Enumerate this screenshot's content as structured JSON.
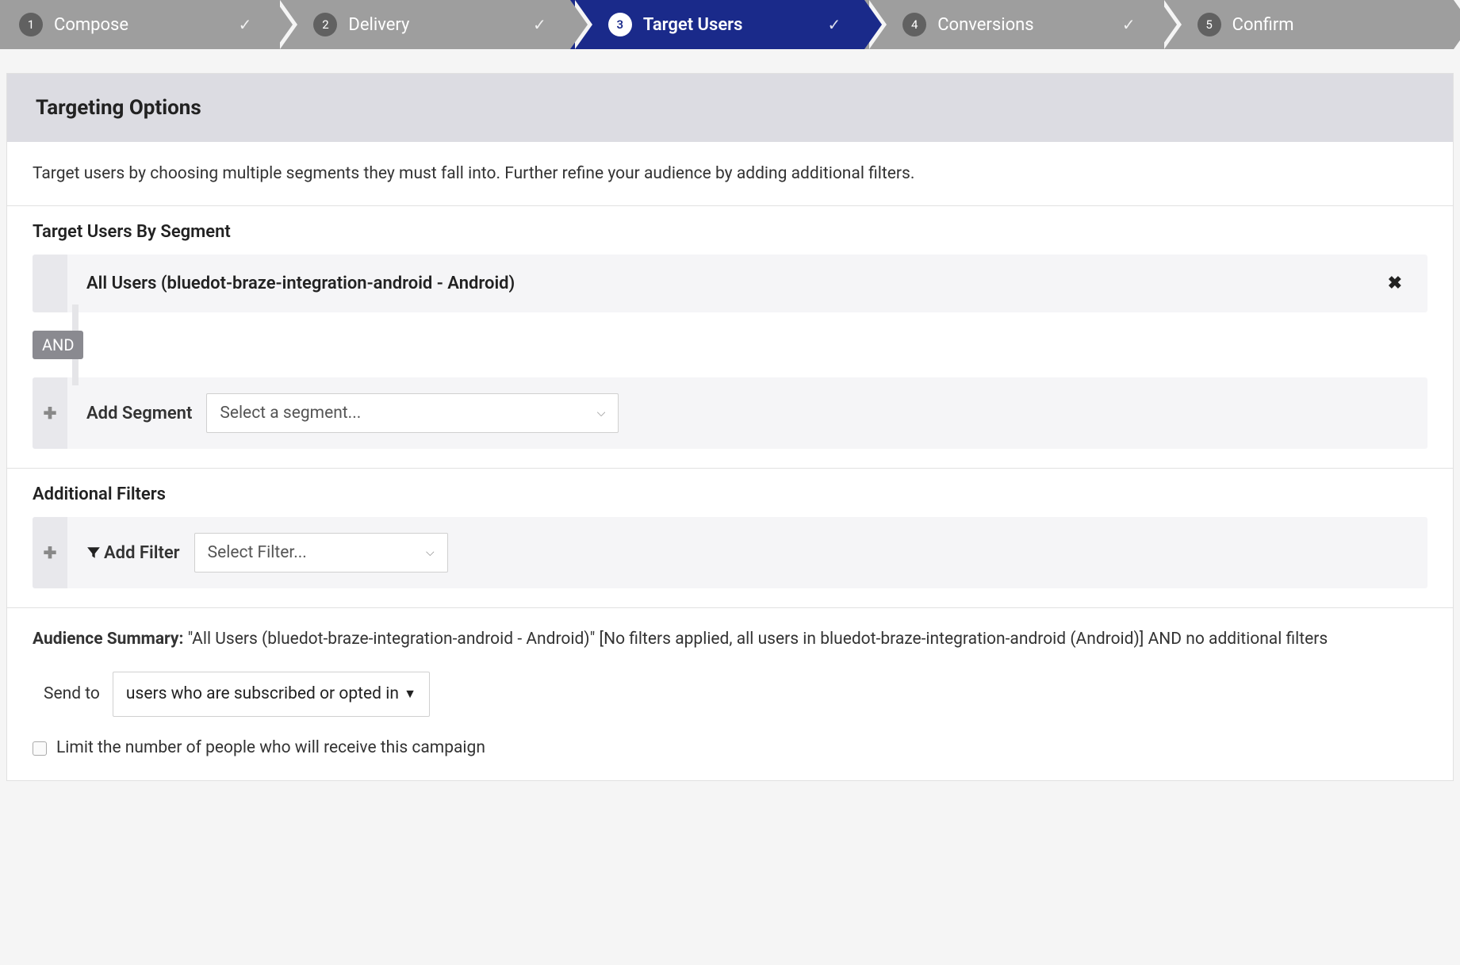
{
  "stepper": {
    "steps": [
      {
        "num": "1",
        "label": "Compose",
        "active": false,
        "checked": true
      },
      {
        "num": "2",
        "label": "Delivery",
        "active": false,
        "checked": true
      },
      {
        "num": "3",
        "label": "Target Users",
        "active": true,
        "checked": true
      },
      {
        "num": "4",
        "label": "Conversions",
        "active": false,
        "checked": true
      },
      {
        "num": "5",
        "label": "Confirm",
        "active": false,
        "checked": false
      }
    ]
  },
  "header": {
    "title": "Targeting Options",
    "description": "Target users by choosing multiple segments they must fall into. Further refine your audience by adding additional filters."
  },
  "segments": {
    "heading": "Target Users By Segment",
    "selected": "All Users (bluedot-braze-integration-android - Android)",
    "connector": "AND",
    "add_label": "Add Segment",
    "select_placeholder": "Select a segment..."
  },
  "filters": {
    "heading": "Additional Filters",
    "add_label": "Add Filter",
    "select_placeholder": "Select Filter..."
  },
  "summary": {
    "label": "Audience Summary:",
    "text": " \"All Users (bluedot-braze-integration-android - Android)\" [No filters applied, all users in bluedot-braze-integration-android (Android)] AND no additional filters",
    "sendto_label": "Send to",
    "sendto_value": "users who are subscribed or opted in",
    "limit_label": "Limit the number of people who will receive this campaign"
  },
  "icons": {
    "check": "✓",
    "plus": "✚",
    "close": "✖",
    "chevron": "⌵",
    "caret": "▼"
  }
}
